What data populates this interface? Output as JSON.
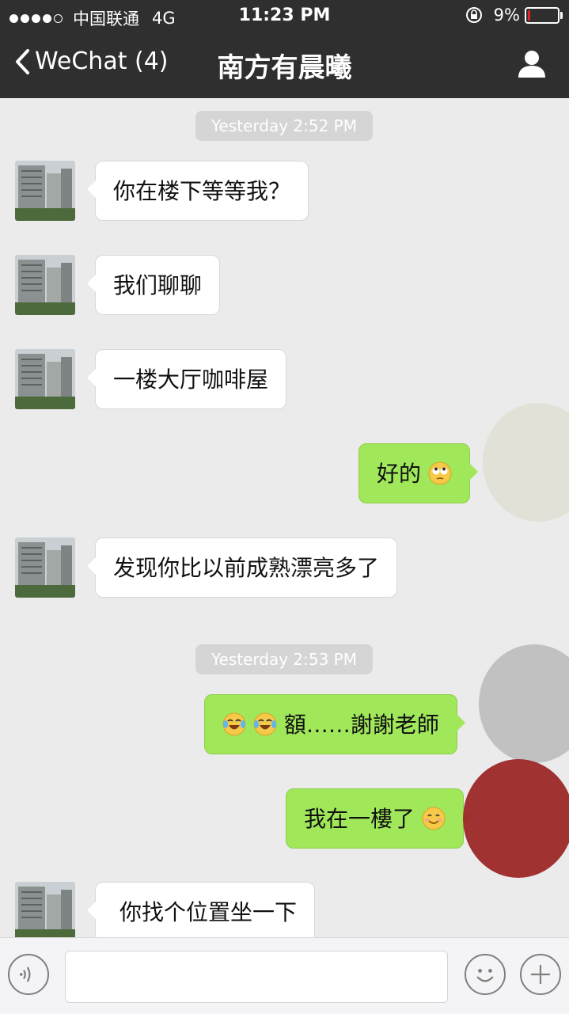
{
  "status_bar": {
    "carrier": "中国联通",
    "network": "4G",
    "time": "11:23 PM",
    "battery_percent": "9%",
    "battery_level": 0.09
  },
  "nav": {
    "back_label": "WeChat (4)",
    "title": "南方有晨曦"
  },
  "chat": {
    "timestamps": [
      "Yesterday 2:52 PM",
      "Yesterday 2:53 PM"
    ],
    "messages": [
      {
        "side": "in",
        "text": "你在楼下等等我？"
      },
      {
        "side": "in",
        "text": "我们聊聊"
      },
      {
        "side": "in",
        "text": "一楼大厅咖啡屋"
      },
      {
        "side": "out",
        "text": "好的",
        "emoji": "rolling-eyes-emoji"
      },
      {
        "side": "in",
        "text": "发现你比以前成熟漂亮多了"
      },
      {
        "side": "out",
        "text": "額……謝謝老師",
        "emoji_prefix": "tears-of-joy-emoji x2"
      },
      {
        "side": "out",
        "text": "我在一樓了",
        "emoji": "smile-emoji"
      },
      {
        "side": "in",
        "text": "你找个位置坐一下"
      }
    ]
  },
  "colors": {
    "nav_bg": "#2f2f2f",
    "chat_bg": "#ebebeb",
    "outgoing_bubble": "#a0e75a",
    "incoming_bubble": "#ffffff",
    "battery_low": "#e2232a"
  },
  "input_bar": {
    "left_icon": "voice-icon",
    "right_icons": [
      "emoji-icon",
      "plus-icon"
    ]
  }
}
